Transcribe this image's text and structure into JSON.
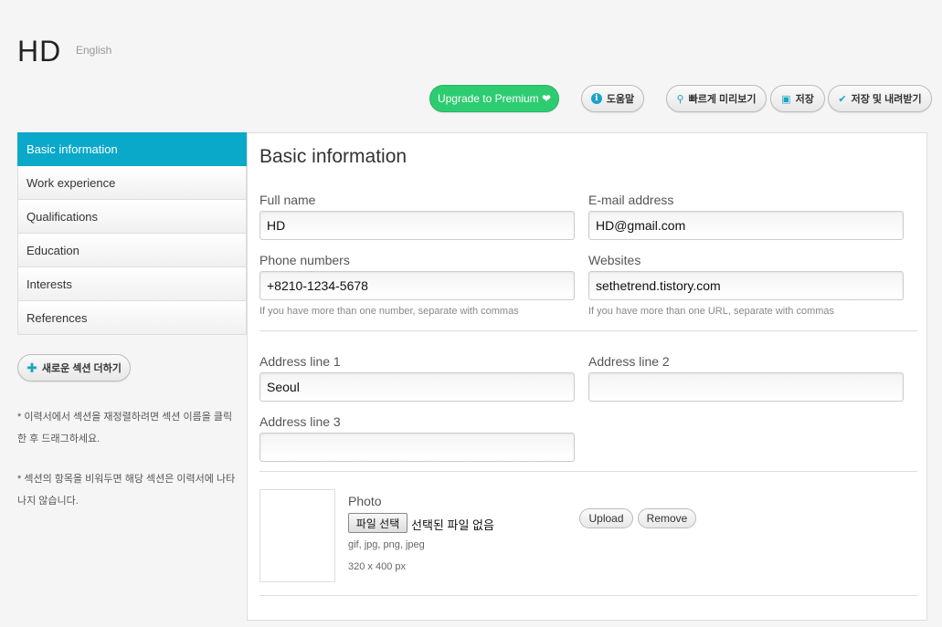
{
  "header": {
    "logo": "HD",
    "language": "English"
  },
  "toolbar": {
    "premium_label": "Upgrade to Premium ❤",
    "help_label": "도움말",
    "preview_label": "빠르게 미리보기",
    "save_label": "저장",
    "save_download_label": "저장 및 내려받기"
  },
  "sidebar": {
    "items": [
      {
        "label": "Basic information",
        "active": true
      },
      {
        "label": "Work experience",
        "active": false
      },
      {
        "label": "Qualifications",
        "active": false
      },
      {
        "label": "Education",
        "active": false
      },
      {
        "label": "Interests",
        "active": false
      },
      {
        "label": "References",
        "active": false
      }
    ],
    "add_section_label": "새로운 섹션 더하기",
    "hint1": "* 이력서에서 섹션을 재정렬하려면 섹션 이름을 클릭한 후 드래그하세요.",
    "hint2": "* 섹션의 항목을 비워두면 해당 섹션은 이력서에 나타나지 않습니다."
  },
  "form": {
    "title": "Basic information",
    "full_name": {
      "label": "Full name",
      "value": "HD"
    },
    "email": {
      "label": "E-mail address",
      "value": "HD@gmail.com"
    },
    "phone": {
      "label": "Phone numbers",
      "value": "+8210-1234-5678",
      "help": "If you have more than one number, separate with commas"
    },
    "websites": {
      "label": "Websites",
      "value": "sethetrend.tistory.com",
      "help": "If you have more than one URL, separate with commas"
    },
    "address1": {
      "label": "Address line 1",
      "value": "Seoul"
    },
    "address2": {
      "label": "Address line 2",
      "value": ""
    },
    "address3": {
      "label": "Address line 3",
      "value": ""
    },
    "photo": {
      "label": "Photo",
      "file_button": "파일 선택",
      "file_status": "선택된 파일 없음",
      "formats": "gif, jpg, png, jpeg",
      "size": "320 x 400 px",
      "upload_label": "Upload",
      "remove_label": "Remove"
    }
  },
  "colors": {
    "accent": "#0aa8c9",
    "premium": "#2ecc71",
    "icon": "#1aa3c7"
  }
}
